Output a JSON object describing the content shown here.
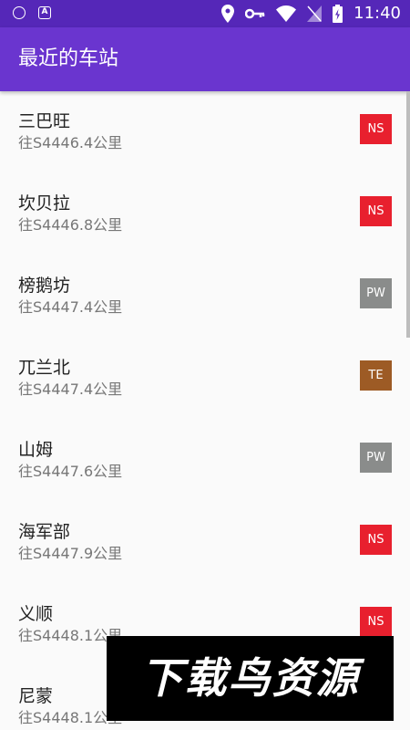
{
  "status_bar": {
    "time": "11:40",
    "icons": [
      "shield-icon",
      "a-icon",
      "location-icon",
      "key-icon",
      "wifi-icon",
      "no-sim-icon",
      "battery-charging-icon"
    ],
    "a_glyph": "A"
  },
  "app_bar": {
    "title": "最近的车站"
  },
  "stations": [
    {
      "name": "三巴旺",
      "distance": "往S4446.4公里",
      "line": "NS",
      "color": "#e8202e"
    },
    {
      "name": "坎贝拉",
      "distance": "往S4446.8公里",
      "line": "NS",
      "color": "#e8202e"
    },
    {
      "name": "榜鹅坊",
      "distance": "往S4447.4公里",
      "line": "PW",
      "color": "#8a8c8b"
    },
    {
      "name": "兀兰北",
      "distance": "往S4447.4公里",
      "line": "TE",
      "color": "#9d5b25"
    },
    {
      "name": "山姆",
      "distance": "往S4447.6公里",
      "line": "PW",
      "color": "#8a8c8b"
    },
    {
      "name": "海军部",
      "distance": "往S4447.9公里",
      "line": "NS",
      "color": "#e8202e"
    },
    {
      "name": "义顺",
      "distance": "往S4448.1公里",
      "line": "NS",
      "color": "#e8202e"
    },
    {
      "name": "尼蒙",
      "distance": "往S4448.1公里",
      "line": "",
      "color": "#e8202e"
    }
  ],
  "watermark": {
    "text": "下载鸟资源"
  },
  "colors": {
    "status_bar": "#5527b8",
    "app_bar": "#6a35cf",
    "background": "#fafafa"
  }
}
